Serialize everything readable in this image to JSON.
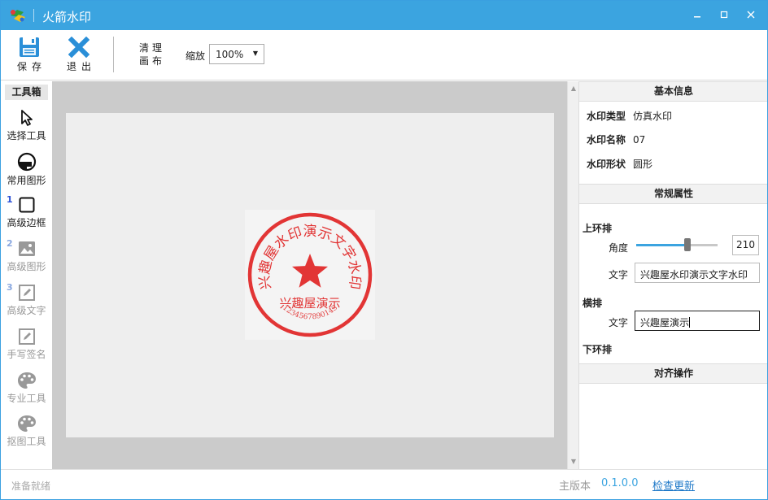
{
  "window": {
    "title": "火箭水印",
    "minimize": "–",
    "maximize": "□",
    "close": "✕"
  },
  "toolbar": {
    "save_label": "保存",
    "exit_label": "退出",
    "clear_label_1": "清理",
    "clear_label_2": "画布",
    "zoom_label": "缩放",
    "zoom_value": "100%"
  },
  "toolbox": {
    "header": "工具箱",
    "tools": [
      {
        "label": "选择工具",
        "icon": "cursor-icon",
        "enabled": true
      },
      {
        "label": "常用图形",
        "icon": "shape-icon",
        "enabled": true
      },
      {
        "label": "高级边框",
        "icon": "square-icon",
        "enabled": true,
        "step": "1"
      },
      {
        "label": "高级图形",
        "icon": "image-icon",
        "enabled": false,
        "step": "2"
      },
      {
        "label": "高级文字",
        "icon": "edit-icon",
        "enabled": false,
        "step": "3"
      },
      {
        "label": "手写签名",
        "icon": "edit-icon",
        "enabled": false
      },
      {
        "label": "专业工具",
        "icon": "palette-icon",
        "enabled": false
      },
      {
        "label": "抠图工具",
        "icon": "palette-icon",
        "enabled": false
      }
    ]
  },
  "stamp": {
    "ring_text": "兴趣屋水印演示文字水印",
    "center_text": "兴趣屋演示",
    "bottom_text": "1234567890143",
    "color": "#e02020"
  },
  "panel": {
    "basic_header": "基本信息",
    "basic_info": [
      {
        "key": "水印类型",
        "value": "仿真水印"
      },
      {
        "key": "水印名称",
        "value": "07"
      },
      {
        "key": "水印形状",
        "value": "圆形"
      }
    ],
    "props_header": "常规属性",
    "upper_ring_title": "上环排",
    "angle_label": "角度",
    "angle_value": "210",
    "angle_fraction": 0.63,
    "text_label": "文字",
    "upper_ring_text": "兴趣屋水印演示文字水印",
    "horizontal_title": "横排",
    "horizontal_text_label": "文字",
    "horizontal_text": "兴趣屋演示",
    "lower_ring_title": "下环排",
    "align_header": "对齐操作"
  },
  "status": {
    "text": "准备就绪",
    "version_label": "主版本",
    "version": "0.1.0.0",
    "update_link": "检查更新"
  },
  "colors": {
    "accent": "#3ba4e0",
    "stamp": "#e02020"
  }
}
